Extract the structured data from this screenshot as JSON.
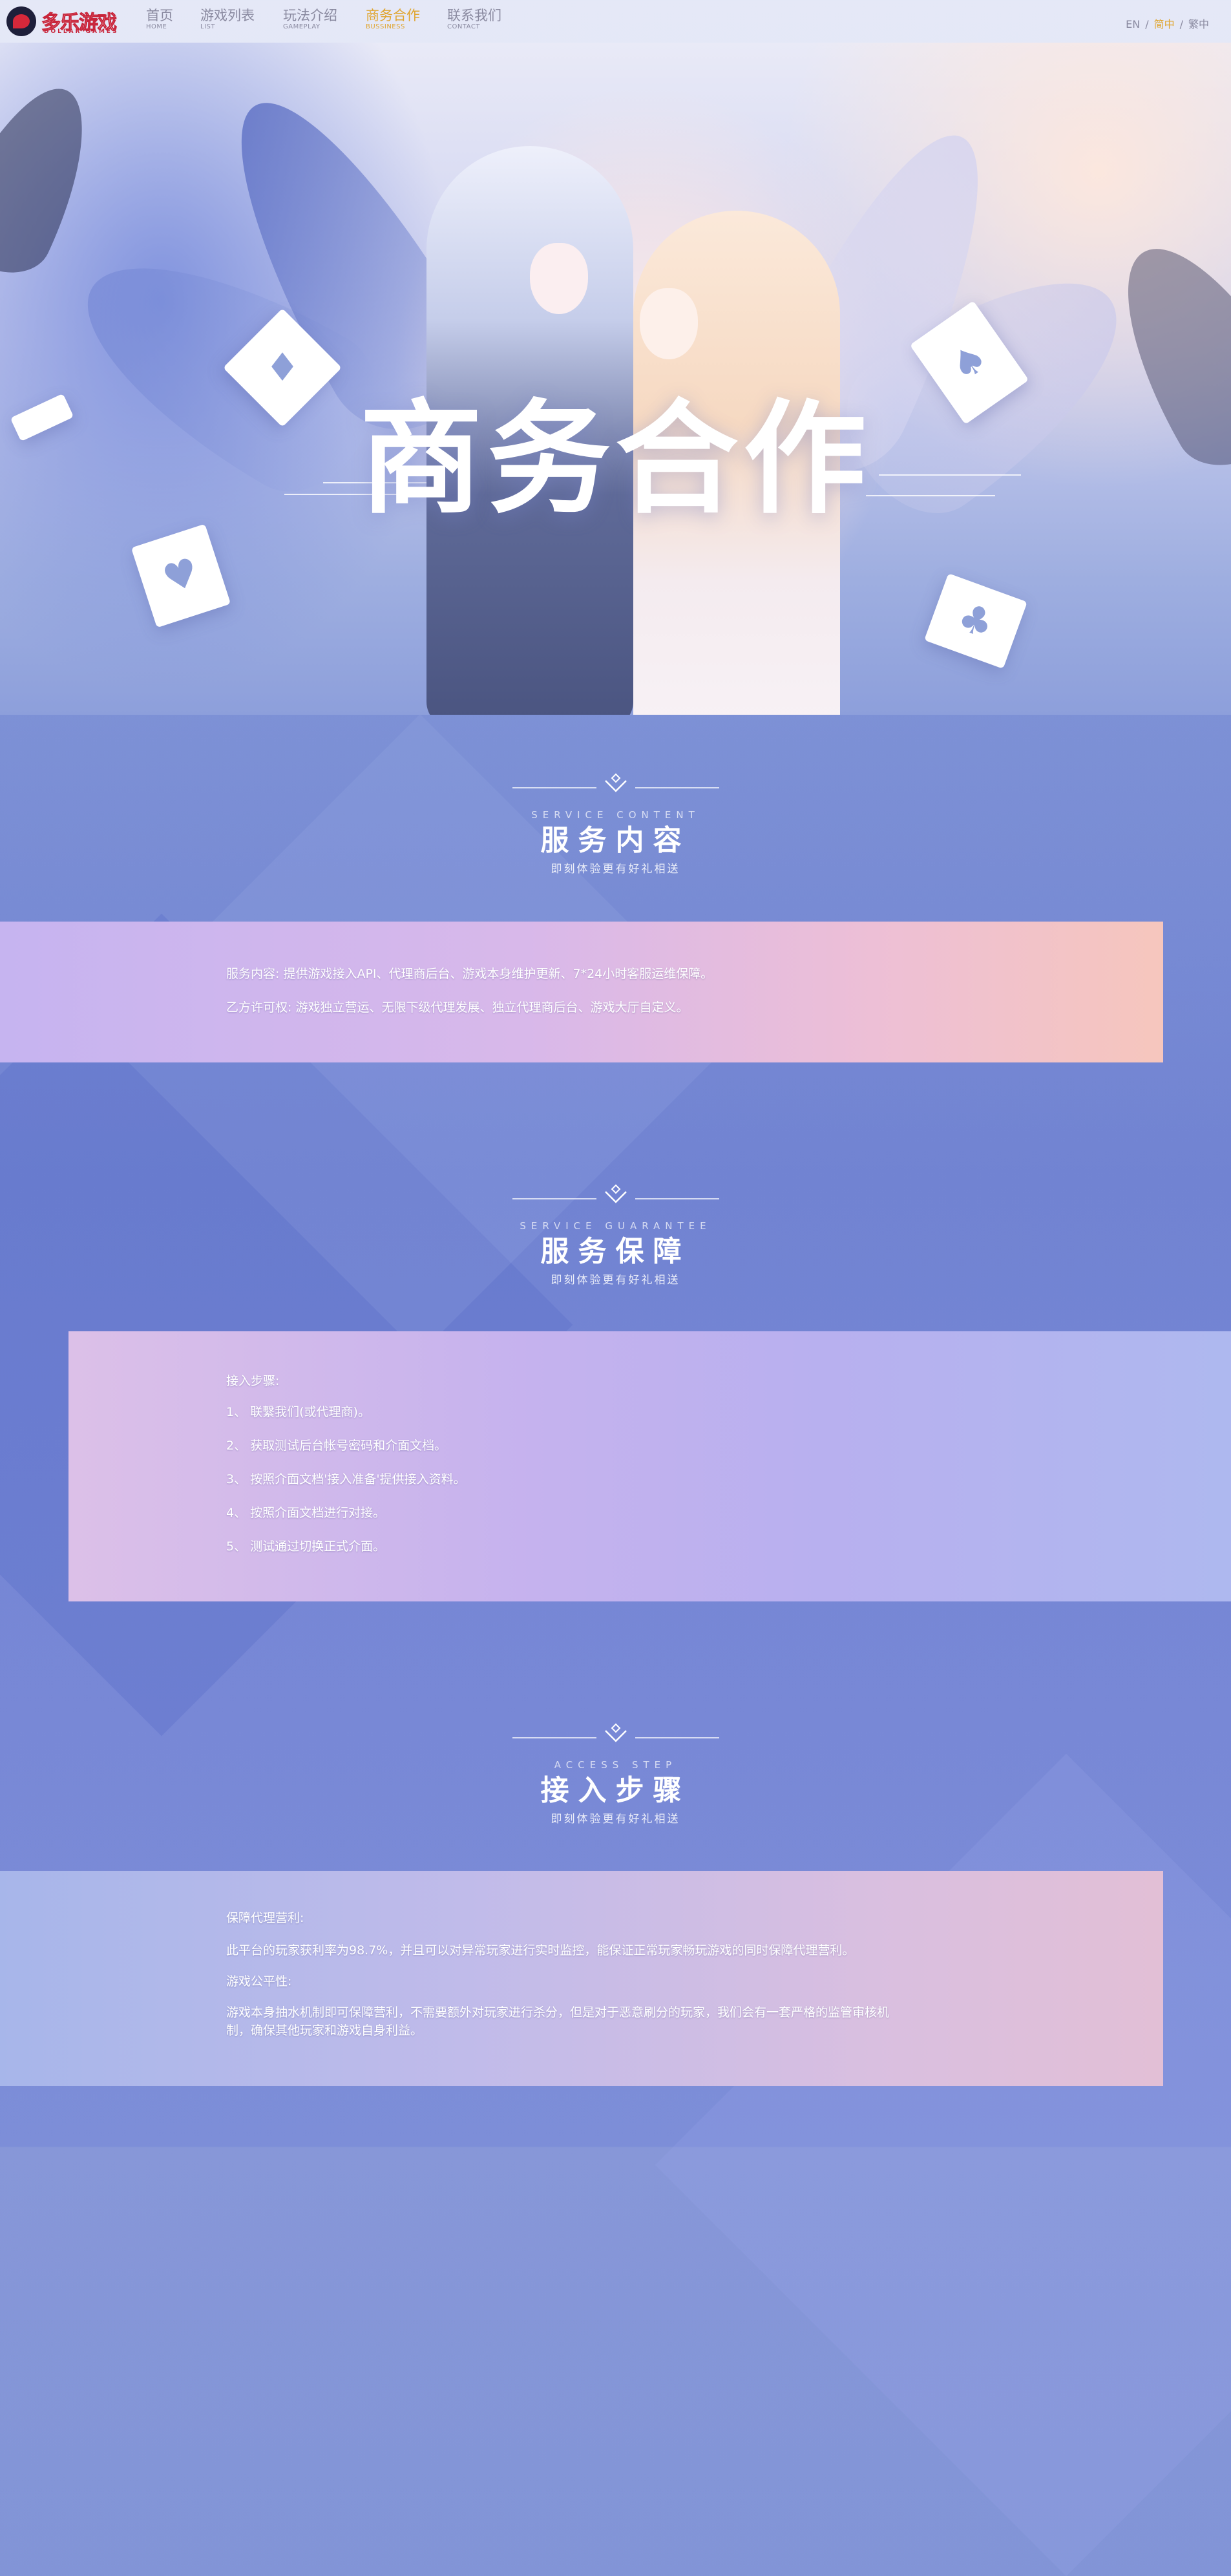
{
  "nav": {
    "logo_text": "多乐游戏",
    "logo_sub": "DOLLAR GAMES",
    "items": [
      {
        "zh": "首页",
        "en": "HOME"
      },
      {
        "zh": "游戏列表",
        "en": "LIST"
      },
      {
        "zh": "玩法介绍",
        "en": "GAMEPLAY"
      },
      {
        "zh": "商务合作",
        "en": "BUSSINESS"
      },
      {
        "zh": "联系我们",
        "en": "CONTACT"
      }
    ],
    "active_index": 3,
    "lang": {
      "en": "EN",
      "sep": "/",
      "zh_cn": "简中",
      "zh_tw": "繁中"
    }
  },
  "hero": {
    "title": "商务合作"
  },
  "sections": [
    {
      "en": "SERVICE CONTENT",
      "zh": "服务内容",
      "sub": "即刻体验更有好礼相送"
    },
    {
      "en": "SERVICE GUARANTEE",
      "zh": "服务保障",
      "sub": "即刻体验更有好礼相送"
    },
    {
      "en": "ACCESS STEP",
      "zh": "接入步骤",
      "sub": "即刻体验更有好礼相送"
    }
  ],
  "panel1": {
    "lines": [
      "服务内容: 提供游戏接入API、代理商后台、游戏本身维护更新、7*24小时客服运维保障。",
      "乙方许可权: 游戏独立营运、无限下级代理发展、独立代理商后台、游戏大厅自定义。"
    ]
  },
  "panel2": {
    "heading": "接入步骤:",
    "steps": [
      "1、 联繫我们(或代理商)。",
      "2、 获取测试后台帐号密码和介面文档。",
      "3、 按照介面文档'接入准备'提供接入资料。",
      "4、 按照介面文档进行对接。",
      "5、 测试通过切换正式介面。"
    ]
  },
  "panel3": {
    "heading1": "保障代理营利:",
    "text1": "此平台的玩家获利率为98.7%，并且可以对异常玩家进行实时监控，能保证正常玩家畅玩游戏的同时保障代理营利。",
    "heading2": "游戏公平性:",
    "text2a": "游戏本身抽水机制即可保障营利，不需要额外对玩家进行杀分，但是对于恶意刷分的玩家，我们会有一套严格的监管审核机",
    "text2b": "制，确保其他玩家和游戏自身利益。"
  },
  "colors": {
    "accent": "#e0a52e",
    "nav_text": "#8a8aa0"
  }
}
